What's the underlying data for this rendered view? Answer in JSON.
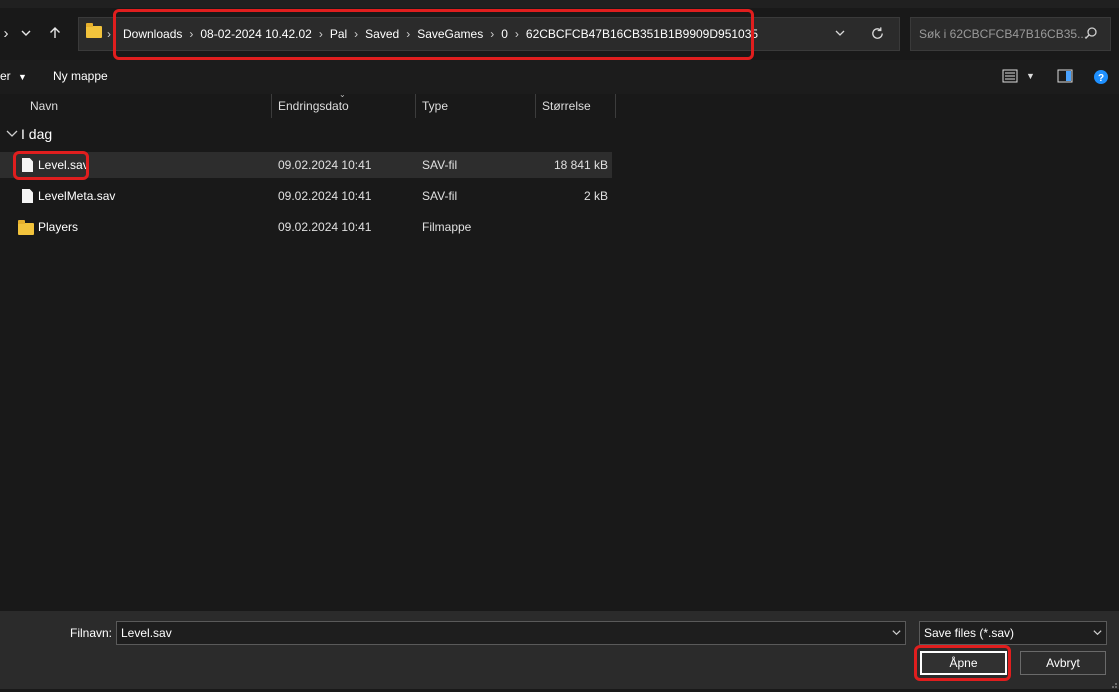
{
  "nav": {
    "down_icon": "chevron-down-icon",
    "up_icon": "arrow-up-icon"
  },
  "breadcrumbs": [
    "Downloads",
    "08-02-2024 10.42.02",
    "Pal",
    "Saved",
    "SaveGames",
    "0",
    "62CBCFCB47B16CB351B1B9909D951035"
  ],
  "search": {
    "placeholder": "Søk i 62CBCFCB47B16CB35..."
  },
  "toolbar": {
    "sort_partial": "er",
    "new_folder": "Ny mappe"
  },
  "columns": {
    "name": "Navn",
    "date": "Endringsdato",
    "type": "Type",
    "size": "Størrelse"
  },
  "group": {
    "title": "I dag"
  },
  "files": [
    {
      "name": "Level.sav",
      "date": "09.02.2024 10:41",
      "type": "SAV-fil",
      "size": "18 841 kB",
      "icon": "file-icon"
    },
    {
      "name": "LevelMeta.sav",
      "date": "09.02.2024 10:41",
      "type": "SAV-fil",
      "size": "2 kB",
      "icon": "file-icon"
    },
    {
      "name": "Players",
      "date": "09.02.2024 10:41",
      "type": "Filmappe",
      "size": "",
      "icon": "folder-icon"
    }
  ],
  "footer": {
    "filename_label": "Filnavn:",
    "filename_value": "Level.sav",
    "filter_value": "Save files (*.sav)",
    "open_label": "Åpne",
    "cancel_label": "Avbryt"
  },
  "colors": {
    "highlight": "#e01e1e",
    "folder": "#f2c33c",
    "help": "#1e90ff"
  }
}
